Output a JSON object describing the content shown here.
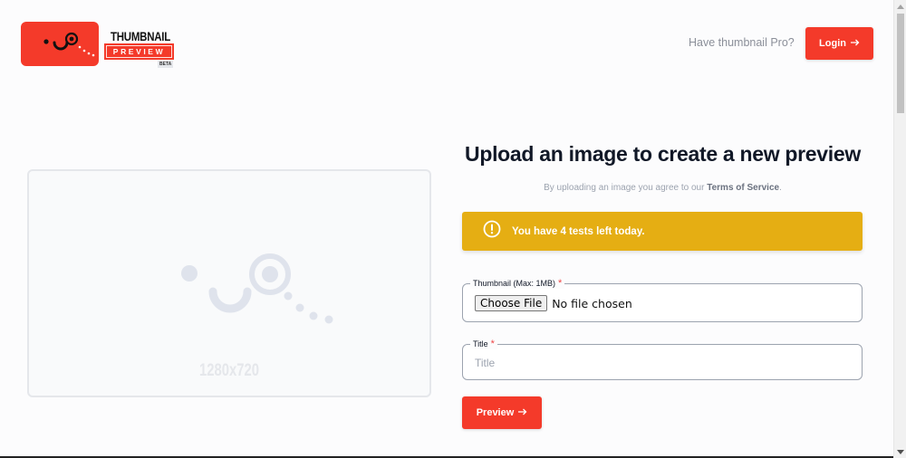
{
  "header": {
    "logo": {
      "top_text": "THUMBNAIL",
      "ribbon_text": "PREVIEW",
      "badge": "BETA"
    },
    "pro_link": "Have thumbnail Pro?",
    "login_label": "Login",
    "login_icon": "arrow-right-icon"
  },
  "preview": {
    "dimensions": "1280x720"
  },
  "upload": {
    "heading": "Upload an image to create a new preview",
    "tos_prefix": "By uploading an image you agree to our ",
    "tos_link": "Terms of Service",
    "tos_suffix": "."
  },
  "alert": {
    "icon": "exclamation-circle-icon",
    "text": "You have 4 tests left today."
  },
  "form": {
    "thumbnail": {
      "label": "Thumbnail (Max: 1MB)",
      "required": "*",
      "button": "Choose File",
      "status": "No file chosen"
    },
    "title": {
      "label": "Title",
      "required": "*",
      "placeholder": "Title",
      "value": ""
    },
    "submit_label": "Preview",
    "submit_icon": "arrow-right-icon"
  },
  "colors": {
    "brand": "#f43a2a",
    "alert": "#e5ae13",
    "placeholder_art": "#dfe3ec"
  }
}
